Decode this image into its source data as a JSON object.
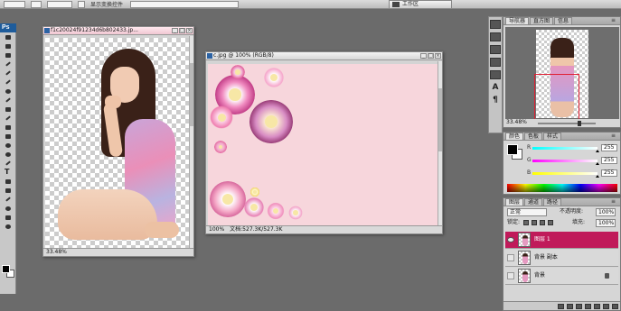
{
  "options_bar": {
    "workspace_label": "工作区",
    "checkbox_label": "显示变换控件"
  },
  "toolbar": {
    "app_logo": "Ps"
  },
  "doc1": {
    "title": "f1c20024f91234d6b802433.jp...",
    "zoom": "33.48%"
  },
  "doc2": {
    "title": "c.jpg @ 100% (RGB/8)",
    "zoom": "100%",
    "doc_size": "文档:527.3K/527.3K"
  },
  "navigator": {
    "tabs": [
      "导航器",
      "直方图",
      "信息"
    ],
    "zoom": "33.48%"
  },
  "color_panel": {
    "tabs": [
      "颜色",
      "色板",
      "样式"
    ],
    "channels": [
      {
        "label": "R",
        "value": "255"
      },
      {
        "label": "G",
        "value": "255"
      },
      {
        "label": "B",
        "value": "255"
      }
    ]
  },
  "layers_panel": {
    "tabs": [
      "图层",
      "通道",
      "路径"
    ],
    "blend_mode": "正常",
    "opacity_label": "不透明度:",
    "opacity_value": "100%",
    "lock_label": "锁定:",
    "fill_label": "填充:",
    "fill_value": "100%",
    "layers": [
      {
        "name": "图层 1",
        "selected": true,
        "visible": true
      },
      {
        "name": "背景 副本",
        "selected": false,
        "visible": false
      },
      {
        "name": "背景",
        "selected": false,
        "visible": false,
        "locked": true
      }
    ]
  },
  "colors": {
    "accent_selected_layer": "#c01a5a",
    "app_background": "#6b6b6b"
  }
}
